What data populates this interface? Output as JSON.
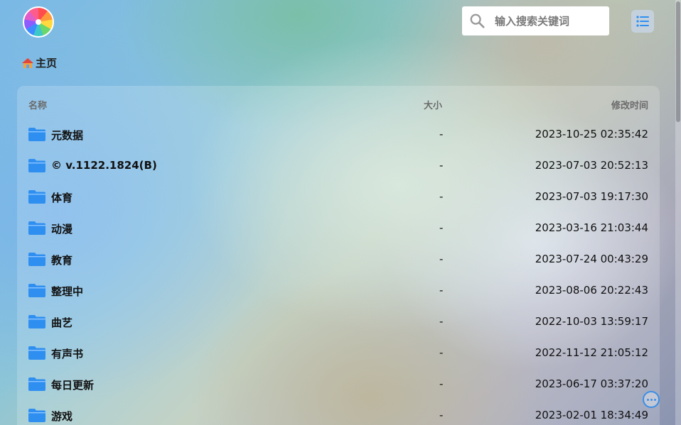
{
  "search": {
    "placeholder": "输入搜索关键词"
  },
  "breadcrumb": {
    "home_label": "主页"
  },
  "table": {
    "headers": {
      "name": "名称",
      "size": "大小",
      "modified": "修改时间"
    },
    "rows": [
      {
        "name": "元数据",
        "size": "-",
        "modified": "2023-10-25 02:35:42"
      },
      {
        "name": "© v.1122.1824(B)",
        "size": "-",
        "modified": "2023-07-03 20:52:13"
      },
      {
        "name": "体育",
        "size": "-",
        "modified": "2023-07-03 19:17:30"
      },
      {
        "name": "动漫",
        "size": "-",
        "modified": "2023-03-16 21:03:44"
      },
      {
        "name": "教育",
        "size": "-",
        "modified": "2023-07-24 00:43:29"
      },
      {
        "name": "整理中",
        "size": "-",
        "modified": "2023-08-06 20:22:43"
      },
      {
        "name": "曲艺",
        "size": "-",
        "modified": "2022-10-03 13:59:17"
      },
      {
        "name": "有声书",
        "size": "-",
        "modified": "2022-11-12 21:05:12"
      },
      {
        "name": "每日更新",
        "size": "-",
        "modified": "2023-06-17 03:37:20"
      },
      {
        "name": "游戏",
        "size": "-",
        "modified": "2023-02-01 18:34:49"
      }
    ]
  },
  "colors": {
    "folder": "#2f8ff0",
    "accent": "#3a8ee6"
  },
  "icons": {
    "logo": "logo-icon",
    "search": "search-icon",
    "list": "list-view-icon",
    "home": "home-icon",
    "folder": "folder-icon",
    "more": "more-icon"
  }
}
